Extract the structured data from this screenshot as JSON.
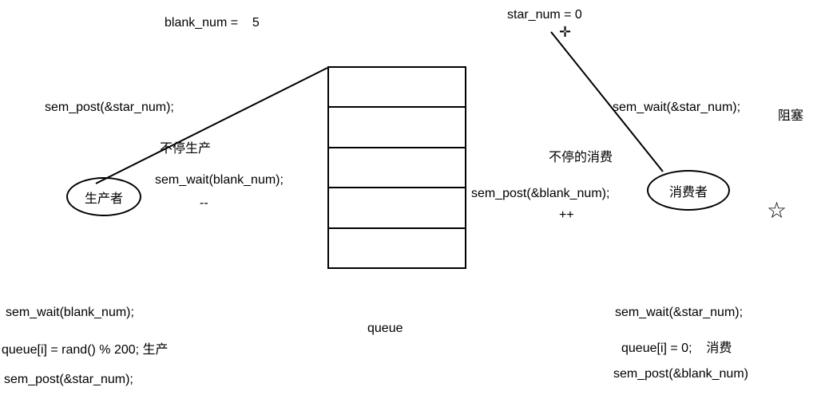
{
  "top": {
    "blank_label": "blank_num =",
    "blank_value": "5",
    "star_label": "star_num = 0"
  },
  "producer": {
    "ellipse_label": "生产者",
    "sem_post": "sem_post(&star_num);",
    "continuous": "不停生产",
    "sem_wait": "sem_wait(blank_num);",
    "decrement": "--"
  },
  "consumer": {
    "ellipse_label": "消费者",
    "sem_wait": "sem_wait(&star_num);",
    "blocked": "阻塞",
    "continuous": "不停的消费",
    "sem_post": "sem_post(&blank_num);",
    "increment": "++"
  },
  "queue_label": "queue",
  "producer_code": {
    "line1": "sem_wait(blank_num);",
    "line2": "queue[i] = rand() % 200; 生产",
    "line3": "sem_post(&star_num);"
  },
  "consumer_code": {
    "line1": "sem_wait(&star_num);",
    "line2_a": "queue[i] = 0;",
    "line2_b": "消费",
    "line3": "sem_post(&blank_num)"
  },
  "icons": {
    "star": "☆",
    "crosshair": "✛"
  }
}
